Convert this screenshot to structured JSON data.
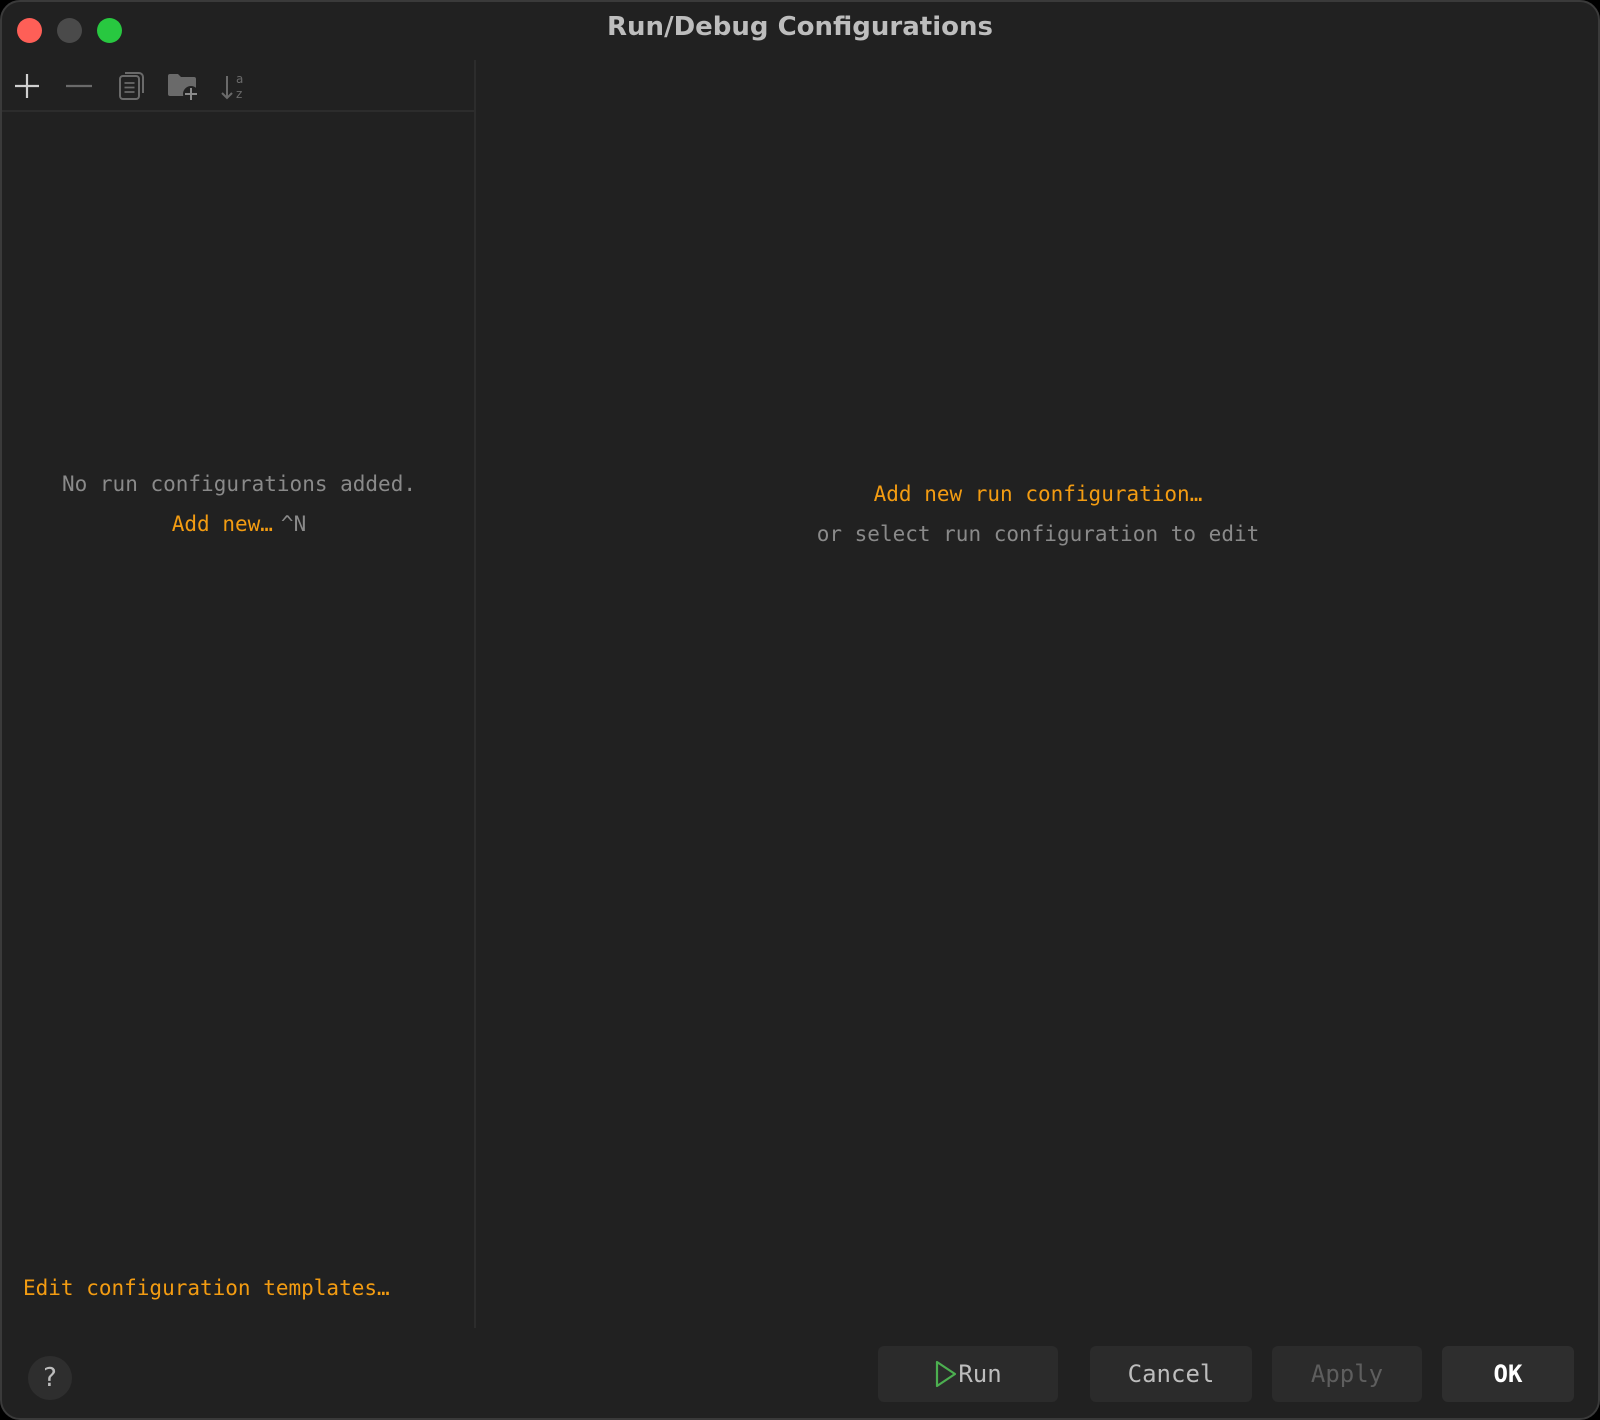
{
  "window": {
    "title": "Run/Debug Configurations"
  },
  "toolbar": {
    "icons": [
      "add-icon",
      "remove-icon",
      "copy-icon",
      "new-folder-icon",
      "sort-alpha-icon"
    ]
  },
  "left_panel": {
    "empty_message": "No run configurations added.",
    "add_new_label": "Add new…",
    "add_new_shortcut": "^N",
    "templates_link": "Edit configuration templates…"
  },
  "right_panel": {
    "add_link": "Add new run configuration…",
    "hint": "or select run configuration to edit"
  },
  "footer": {
    "help_label": "?",
    "run_label": "Run",
    "cancel_label": "Cancel",
    "apply_label": "Apply",
    "ok_label": "OK"
  },
  "colors": {
    "link": "#f39c12",
    "background": "#212121",
    "run_icon": "#4caf50"
  }
}
